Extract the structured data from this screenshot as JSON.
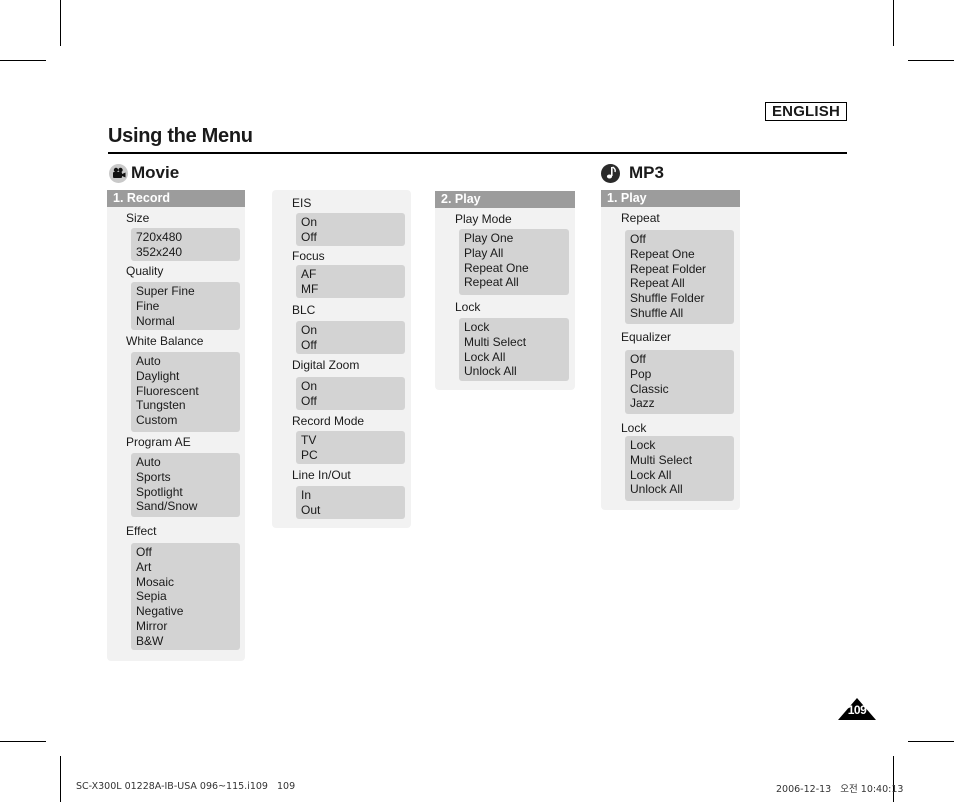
{
  "language_badge": "ENGLISH",
  "page_title": "Using the Menu",
  "sections": {
    "movie": {
      "title": "Movie",
      "icon": "movie-camera-icon"
    },
    "mp3": {
      "title": "MP3",
      "icon": "music-note-icon"
    }
  },
  "panels": {
    "record": {
      "header": "1. Record",
      "groups": [
        {
          "label": "Size",
          "options": [
            "720x480",
            "352x240"
          ]
        },
        {
          "label": "Quality",
          "options": [
            "Super Fine",
            "Fine",
            "Normal"
          ]
        },
        {
          "label": "White Balance",
          "options": [
            "Auto",
            "Daylight",
            "Fluorescent",
            "Tungsten",
            "Custom"
          ]
        },
        {
          "label": "Program AE",
          "options": [
            "Auto",
            "Sports",
            "Spotlight",
            "Sand/Snow"
          ]
        },
        {
          "label": "Effect",
          "options": [
            "Off",
            "Art",
            "Mosaic",
            "Sepia",
            "Negative",
            "Mirror",
            "B&W"
          ]
        }
      ]
    },
    "record_cont": {
      "groups": [
        {
          "label": "EIS",
          "options": [
            "On",
            "Off"
          ]
        },
        {
          "label": "Focus",
          "options": [
            "AF",
            "MF"
          ]
        },
        {
          "label": "BLC",
          "options": [
            "On",
            "Off"
          ]
        },
        {
          "label": "Digital Zoom",
          "options": [
            "On",
            "Off"
          ]
        },
        {
          "label": "Record Mode",
          "options": [
            "TV",
            "PC"
          ]
        },
        {
          "label": "Line In/Out",
          "options": [
            "In",
            "Out"
          ]
        }
      ]
    },
    "movie_play": {
      "header": "2. Play",
      "groups": [
        {
          "label": "Play Mode",
          "options": [
            "Play One",
            "Play All",
            "Repeat One",
            "Repeat All"
          ]
        },
        {
          "label": "Lock",
          "options": [
            "Lock",
            "Multi Select",
            "Lock All",
            "Unlock All"
          ]
        }
      ]
    },
    "mp3_play": {
      "header": "1. Play",
      "groups": [
        {
          "label": "Repeat",
          "options": [
            "Off",
            "Repeat One",
            "Repeat Folder",
            "Repeat All",
            "Shuffle Folder",
            "Shuffle All"
          ]
        },
        {
          "label": "Equalizer",
          "options": [
            "Off",
            "Pop",
            "Classic",
            "Jazz"
          ]
        },
        {
          "label": "Lock",
          "options": [
            "Lock",
            "Multi Select",
            "Lock All",
            "Unlock All"
          ]
        }
      ]
    }
  },
  "page_number": "109",
  "footer": {
    "left": "SC-X300L 01228A-IB-USA 096~115.i109   109",
    "right": "2006-12-13   오전 10:40:13"
  }
}
